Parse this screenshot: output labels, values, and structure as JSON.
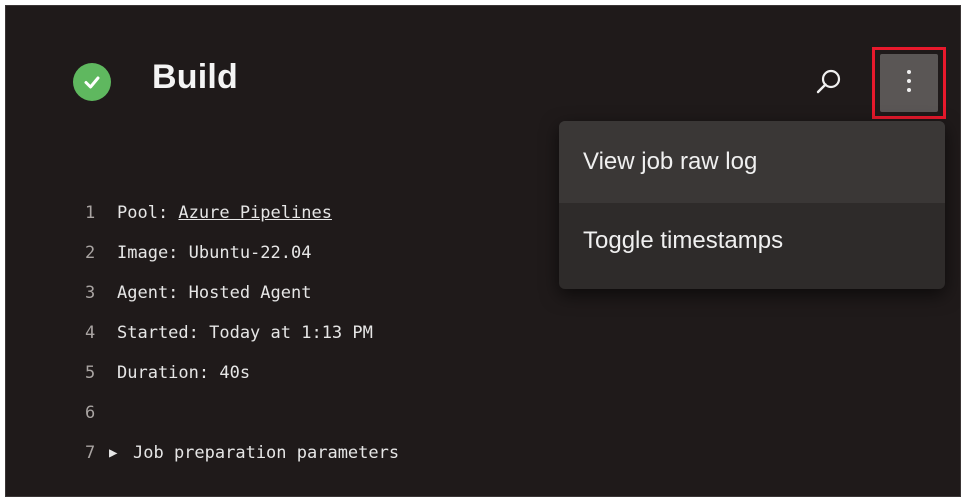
{
  "header": {
    "title": "Build"
  },
  "menu": {
    "items": [
      {
        "label": "View job raw log"
      },
      {
        "label": "Toggle timestamps"
      }
    ]
  },
  "log": {
    "lines": [
      {
        "num": "1",
        "prefix": "Pool: ",
        "link": "Azure Pipelines"
      },
      {
        "num": "2",
        "text": "Image: Ubuntu-22.04"
      },
      {
        "num": "3",
        "text": "Agent: Hosted Agent"
      },
      {
        "num": "4",
        "text": "Started: Today at 1:13 PM"
      },
      {
        "num": "5",
        "text": "Duration: 40s"
      },
      {
        "num": "6",
        "text": ""
      },
      {
        "num": "7",
        "expander": "▶",
        "text": "Job preparation parameters"
      }
    ]
  },
  "colors": {
    "success": "#5fb85f",
    "highlight": "#e8192c",
    "panel_bg": "#1f1a1a"
  }
}
